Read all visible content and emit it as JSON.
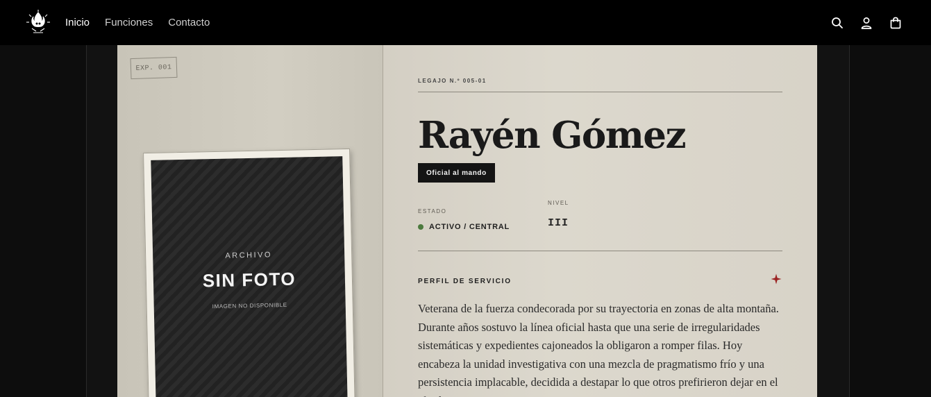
{
  "nav": {
    "logo_icon": "flame-skull-icon",
    "links": [
      {
        "label": "Inicio",
        "active": true
      },
      {
        "label": "Funciones",
        "active": false
      },
      {
        "label": "Contacto",
        "active": false
      }
    ],
    "icons": [
      "search-icon",
      "user-icon",
      "bag-icon"
    ]
  },
  "dossier": {
    "stamp": "EXP. 001",
    "photo": {
      "kicker": "ARCHIVO",
      "title": "SIN FOTO",
      "subtitle": "IMAGEN NO DISPONIBLE"
    },
    "id": "LEGAJO N.º 005-01",
    "name": "Rayén Gómez",
    "rank": "Oficial al mando",
    "status_label": "ESTADO",
    "status_value": "ACTIVO / CENTRAL",
    "status_color": "#4c7a3e",
    "level_label": "NIVEL",
    "level_value": "III",
    "section_title": "PERFIL DE SERVICIO",
    "accent_color": "#9b2222",
    "bio": "Veterana de la fuerza condecorada por su trayectoria en zonas de alta montaña. Durante años sostuvo la línea oficial hasta que una serie de irregularidades sistemáticas y expedientes cajoneados la obligaron a romper filas. Hoy encabeza la unidad investigativa con una mezcla de pragmatismo frío y una persistencia implacable, decidida a destapar lo que otros prefirieron dejar en el olvido."
  }
}
